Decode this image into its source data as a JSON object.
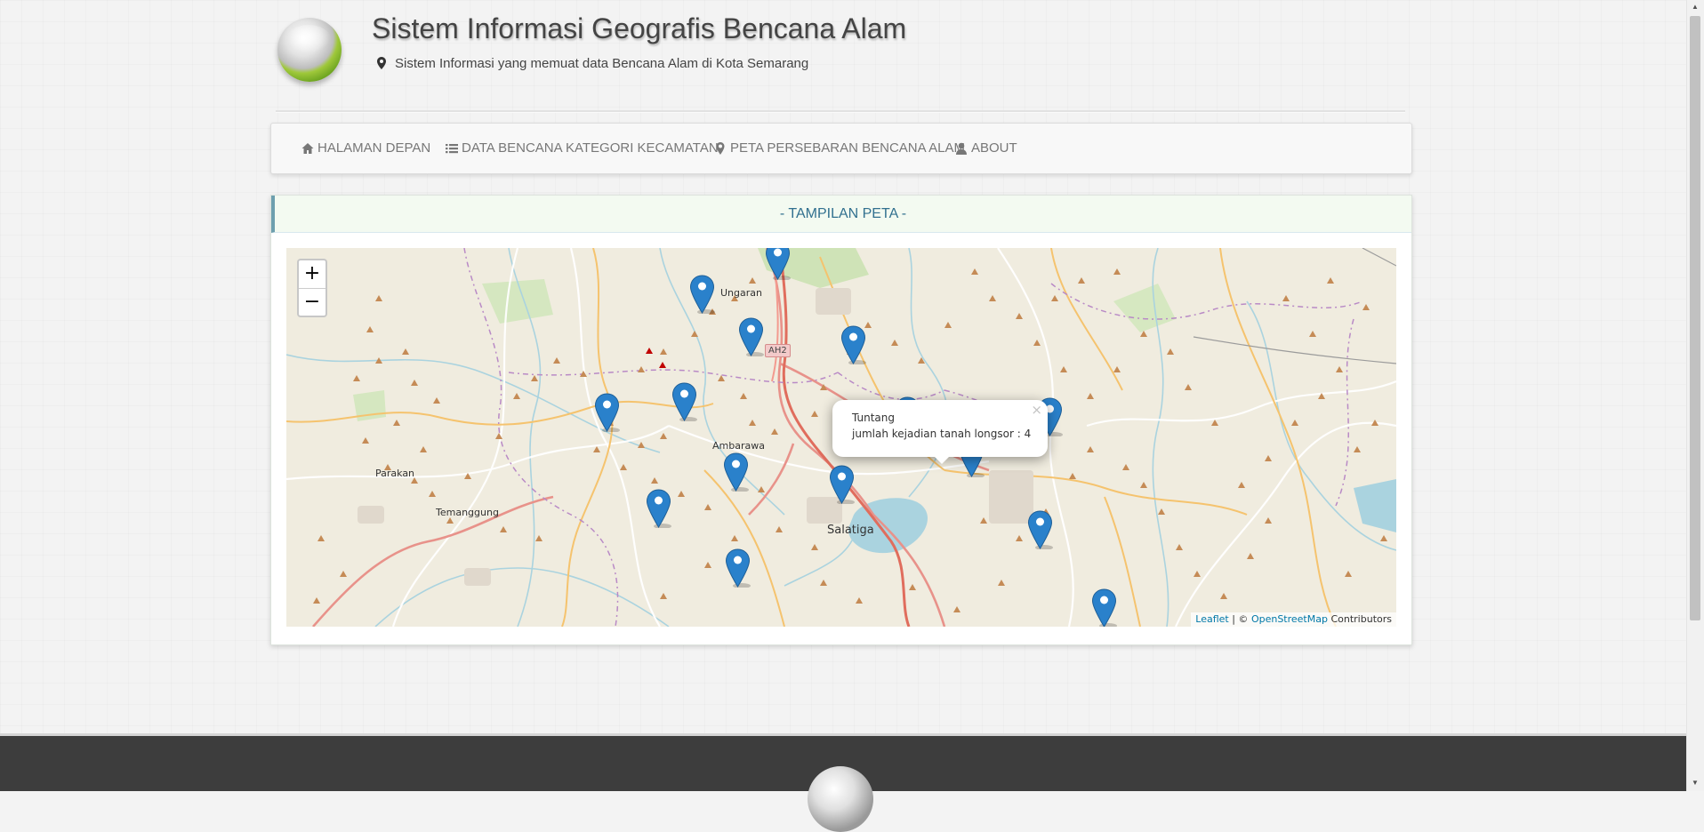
{
  "header": {
    "title": "Sistem Informasi Geografis Bencana Alam",
    "subtitle": "Sistem Informasi yang memuat data Bencana Alam di Kota Semarang"
  },
  "nav": {
    "items": [
      {
        "label": "HALAMAN DEPAN",
        "icon": "home-icon"
      },
      {
        "label": "DATA BENCANA KATEGORI KECAMATAN",
        "icon": "list-icon"
      },
      {
        "label": "PETA PERSEBARAN BENCANA ALAM",
        "icon": "map-marker-icon"
      },
      {
        "label": "ABOUT",
        "icon": "user-icon"
      }
    ]
  },
  "panel": {
    "heading": "- TAMPILAN PETA -"
  },
  "map": {
    "zoom_in": "+",
    "zoom_out": "−",
    "place_labels": [
      "Ungaran",
      "AH2",
      "Ambarawa",
      "Parakan",
      "Temanggung",
      "Salatiga"
    ],
    "popup": {
      "title": "Tuntang",
      "text": "jumlah kejadian tanah longsor : 4",
      "close": "×"
    },
    "attribution": {
      "leaflet": "Leaflet",
      "separator": " | © ",
      "osm": "OpenStreetMap",
      "suffix": " Contributors"
    },
    "marker_color": "#2a81cb"
  },
  "colors": {
    "accent_heading": "#31708f",
    "footer": "#3d3d3d",
    "link": "#0078a8"
  }
}
